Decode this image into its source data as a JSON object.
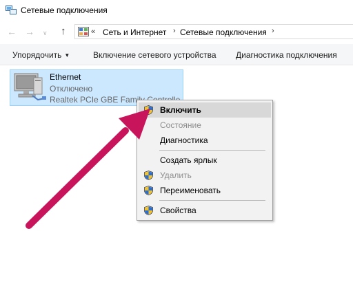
{
  "window": {
    "title": "Сетевые подключения"
  },
  "navigation": {
    "back_glyph": "←",
    "forward_glyph": "→",
    "recent_glyph": "∨",
    "up_glyph": "↑",
    "breadcrumb_more": "«",
    "breadcrumbs": [
      "Сеть и Интернет",
      "Сетевые подключения"
    ],
    "separator": "›"
  },
  "toolbar": {
    "organize_label": "Упорядочить",
    "organize_dropdown": "▼",
    "enable_device_label": "Включение сетевого устройства",
    "diagnostics_label": "Диагностика подключения"
  },
  "connection": {
    "name": "Ethernet",
    "status": "Отключено",
    "device": "Realtek PCIe GBE Family Controller"
  },
  "context_menu": {
    "items": [
      {
        "label": "Включить",
        "shield": true,
        "disabled": false,
        "highlighted": true
      },
      {
        "label": "Состояние",
        "shield": false,
        "disabled": true,
        "highlighted": false
      },
      {
        "label": "Диагностика",
        "shield": false,
        "disabled": false,
        "highlighted": false
      },
      {
        "label": "Создать ярлык",
        "shield": false,
        "disabled": false,
        "highlighted": false
      },
      {
        "label": "Удалить",
        "shield": true,
        "disabled": true,
        "highlighted": false
      },
      {
        "label": "Переименовать",
        "shield": true,
        "disabled": false,
        "highlighted": false
      },
      {
        "label": "Свойства",
        "shield": true,
        "disabled": false,
        "highlighted": false
      }
    ]
  },
  "colors": {
    "selection_bg": "#cce8ff",
    "selection_border": "#99d1ff",
    "arrow": "#c8145a",
    "menu_bg": "#f2f2f2",
    "menu_highlight": "#d8d8d8"
  },
  "icons": {
    "window": "network-connections-icon",
    "device": "network-computer-icon",
    "uac": "uac-shield-icon",
    "annotation": "pointer-arrow"
  }
}
